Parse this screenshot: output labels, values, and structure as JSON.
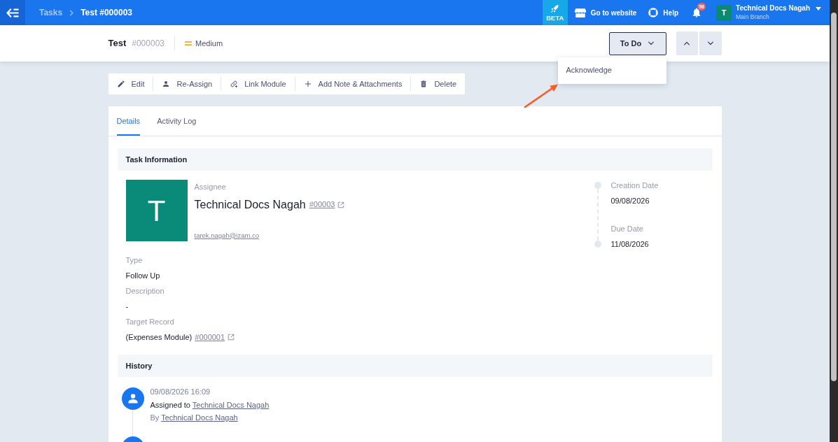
{
  "top_bar": {
    "breadcrumb": [
      {
        "label": "Tasks",
        "current": false
      },
      {
        "label": "Test #000003",
        "current": true
      }
    ],
    "beta": {
      "label": "BETA"
    },
    "links": [
      {
        "kind": "website",
        "label": "Go to website"
      },
      {
        "kind": "help",
        "label": "Help"
      }
    ],
    "notifications": {
      "count": "58"
    },
    "user": {
      "initial": "T",
      "name": "Technical Docs Nagah",
      "branch": "Main Branch"
    }
  },
  "header": {
    "title": "Test",
    "number": "#000003",
    "priority": {
      "label": "Medium"
    },
    "status": {
      "label": "To Do",
      "expanded": true
    }
  },
  "status_menu": {
    "items": [
      {
        "label": "Acknowledge"
      }
    ]
  },
  "actions": [
    {
      "kind": "edit",
      "label": "Edit"
    },
    {
      "kind": "reassign",
      "label": "Re-Assign"
    },
    {
      "kind": "link",
      "label": "Link Module"
    },
    {
      "kind": "add",
      "label": "Add Note & Attachments"
    },
    {
      "kind": "delete",
      "label": "Delete"
    }
  ],
  "tabs": [
    {
      "label": "Details",
      "selected": true
    },
    {
      "label": "Activity Log",
      "selected": false
    }
  ],
  "task_information": {
    "title": "Task Information",
    "assignee": {
      "label": "Assignee",
      "initial": "T",
      "name": "Technical Docs Nagah",
      "number": "#00003",
      "email": "tarek.nagah@izam.co"
    },
    "dates": [
      {
        "label": "Creation Date",
        "value": "09/08/2026"
      },
      {
        "label": "Due Date",
        "value": "11/08/2026"
      }
    ],
    "fields": [
      {
        "label": "Type",
        "value": "Follow Up"
      },
      {
        "label": "Description",
        "value": "-"
      },
      {
        "label": "Target Record",
        "value": "(Expenses Module)",
        "link": "#000001"
      }
    ]
  },
  "history": {
    "title": "History",
    "entries": [
      {
        "kind": "event",
        "time": "09/08/2026 16:09",
        "action": "Assigned to",
        "target": "Technical Docs Nagah",
        "by_label": "By",
        "by": "Technical Docs Nagah"
      },
      {
        "kind": "partial"
      }
    ]
  }
}
